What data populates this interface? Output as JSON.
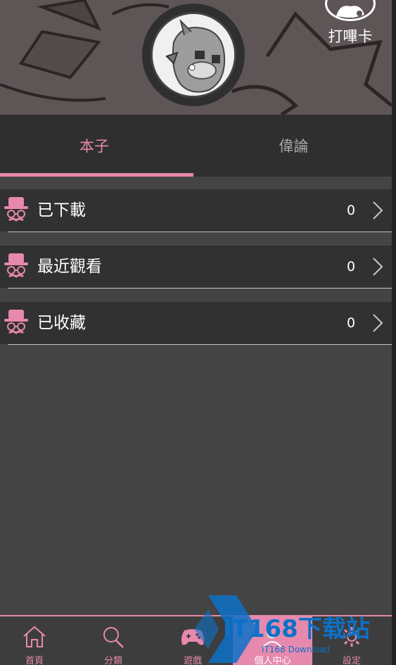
{
  "header": {
    "checkin_label": "打嗶卡"
  },
  "tabs": [
    {
      "label": "本子",
      "active": true
    },
    {
      "label": "偉論",
      "active": false
    }
  ],
  "list": [
    {
      "label": "已下載",
      "count": "0"
    },
    {
      "label": "最近觀看",
      "count": "0"
    },
    {
      "label": "已收藏",
      "count": "0"
    }
  ],
  "nav": [
    {
      "label": "首頁",
      "icon": "home-icon"
    },
    {
      "label": "分類",
      "icon": "search-icon"
    },
    {
      "label": "遊戲",
      "icon": "gamepad-icon"
    },
    {
      "label": "個人中心",
      "icon": "person-icon",
      "active": true
    },
    {
      "label": "設定",
      "icon": "gear-icon"
    }
  ],
  "watermark": {
    "text": "IT168下载站",
    "sub": "IT168 Download"
  },
  "colors": {
    "accent": "#e689ad",
    "row_bg": "#313131",
    "page_bg": "#444444",
    "tab_bar_bg": "#2f2f2f",
    "watermark": "#0c72c8"
  }
}
